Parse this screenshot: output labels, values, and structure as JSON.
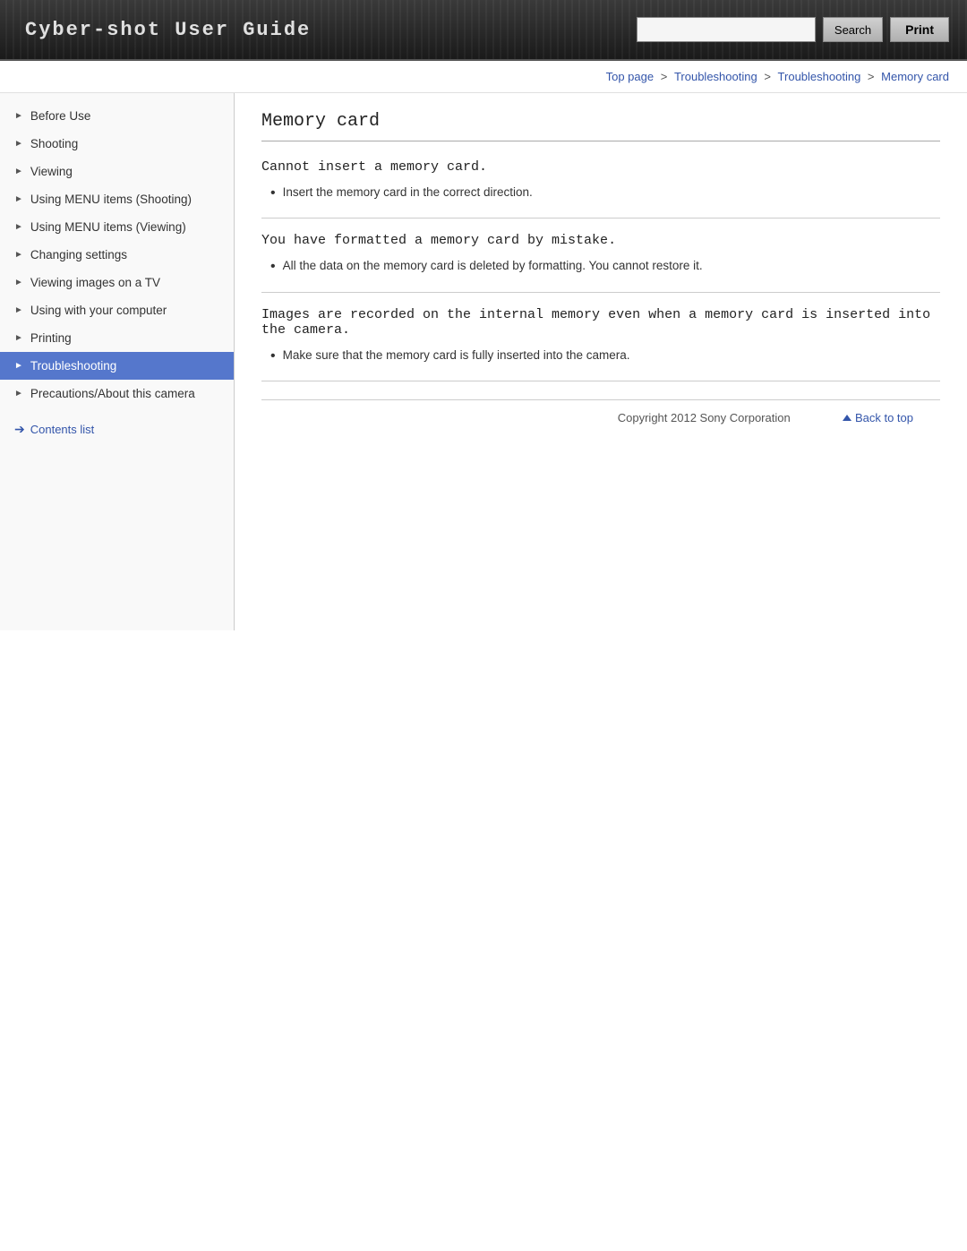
{
  "header": {
    "title": "Cyber-shot User Guide",
    "search_placeholder": "",
    "search_button_label": "Search",
    "print_button_label": "Print"
  },
  "breadcrumb": {
    "items": [
      {
        "label": "Top page",
        "href": "#"
      },
      {
        "label": "Troubleshooting",
        "href": "#"
      },
      {
        "label": "Troubleshooting",
        "href": "#"
      },
      {
        "label": "Memory card",
        "href": "#"
      }
    ],
    "separator": ">"
  },
  "sidebar": {
    "items": [
      {
        "id": "before-use",
        "label": "Before Use",
        "active": false
      },
      {
        "id": "shooting",
        "label": "Shooting",
        "active": false
      },
      {
        "id": "viewing",
        "label": "Viewing",
        "active": false
      },
      {
        "id": "using-menu-shooting",
        "label": "Using MENU items (Shooting)",
        "active": false
      },
      {
        "id": "using-menu-viewing",
        "label": "Using MENU items (Viewing)",
        "active": false
      },
      {
        "id": "changing-settings",
        "label": "Changing settings",
        "active": false
      },
      {
        "id": "viewing-tv",
        "label": "Viewing images on a TV",
        "active": false
      },
      {
        "id": "using-computer",
        "label": "Using with your computer",
        "active": false
      },
      {
        "id": "printing",
        "label": "Printing",
        "active": false
      },
      {
        "id": "troubleshooting",
        "label": "Troubleshooting",
        "active": true
      },
      {
        "id": "precautions",
        "label": "Precautions/About this camera",
        "active": false
      }
    ],
    "contents_list_label": "Contents list"
  },
  "main": {
    "page_title": "Memory card",
    "sections": [
      {
        "id": "section-1",
        "heading": "Cannot insert a memory card.",
        "bullets": [
          "Insert the memory card in the correct direction."
        ]
      },
      {
        "id": "section-2",
        "heading": "You have formatted a memory card by mistake.",
        "bullets": [
          "All the data on the memory card is deleted by formatting. You cannot restore it."
        ]
      },
      {
        "id": "section-3",
        "heading": "Images are recorded on the internal memory even when a memory card is inserted into the camera.",
        "bullets": [
          "Make sure that the memory card is fully inserted into the camera."
        ]
      }
    ]
  },
  "footer": {
    "copyright": "Copyright 2012 Sony Corporation",
    "back_to_top": "Back to top"
  }
}
